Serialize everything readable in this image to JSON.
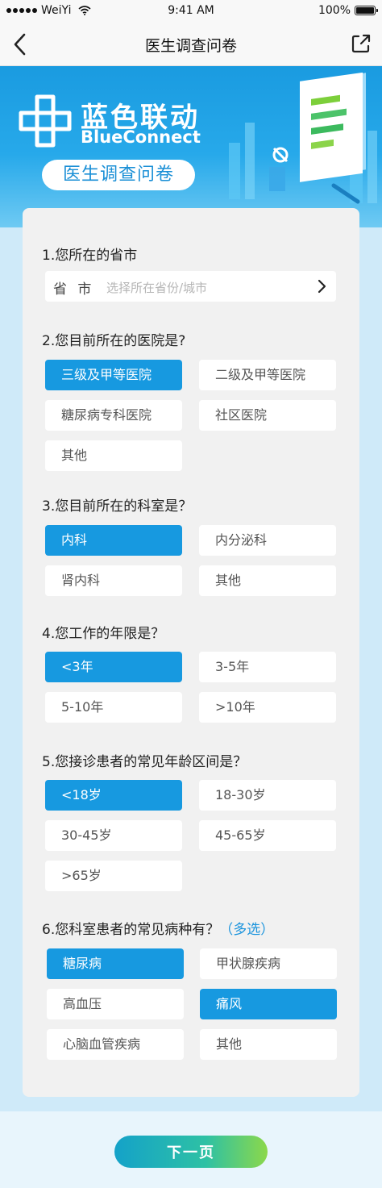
{
  "status_bar": {
    "carrier": "WeiYi",
    "time": "9:41 AM",
    "battery": "100%",
    "battery_level": 1.0
  },
  "nav": {
    "title": "医生调查问卷"
  },
  "banner": {
    "brand_cn": "蓝色联动",
    "brand_en": "BlueConnect",
    "pill": "医生调查问卷"
  },
  "q1": {
    "title": "1.您所在的省市",
    "label": "省 市",
    "placeholder": "选择所在省份/城市"
  },
  "q2": {
    "title": "2.您目前所在的医院是?",
    "options": [
      "三级及甲等医院",
      "二级及甲等医院",
      "糖尿病专科医院",
      "社区医院",
      "其他"
    ],
    "selected": [
      0
    ]
  },
  "q3": {
    "title": "3.您目前所在的科室是？",
    "options": [
      "内科",
      "内分泌科",
      "肾内科",
      "其他"
    ],
    "selected": [
      0
    ]
  },
  "q4": {
    "title": "4.您工作的年限是？",
    "options": [
      "<3年",
      "3-5年",
      "5-10年",
      ">10年"
    ],
    "selected": [
      0
    ]
  },
  "q5": {
    "title": "5.您接诊患者的常见年龄区间是？",
    "options": [
      "<18岁",
      "18-30岁",
      "30-45岁",
      "45-65岁",
      ">65岁"
    ],
    "selected": [
      0
    ]
  },
  "q6": {
    "title": "6.您科室患者的常见病种有？",
    "multi_label": "（多选）",
    "options": [
      "糖尿病",
      "甲状腺疾病",
      "高血压",
      "痛风",
      "心脑血管疾病",
      "其他"
    ],
    "selected": [
      0,
      3
    ]
  },
  "footer": {
    "next_label": "下一页"
  },
  "colors": {
    "accent": "#1799e0",
    "banner_top": "#1a9be0",
    "button_start": "#14a2c9",
    "button_end": "#8cd84a"
  }
}
